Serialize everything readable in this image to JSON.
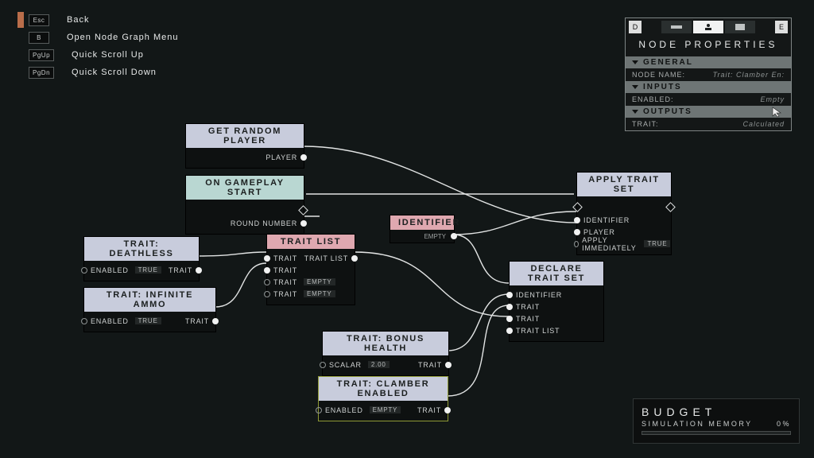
{
  "legend": {
    "rows": [
      {
        "key": "Esc",
        "label": "Back"
      },
      {
        "key": "B",
        "label": "Open Node Graph Menu"
      },
      {
        "key": "PgUp",
        "label": "Quick Scroll Up"
      },
      {
        "key": "PgDn",
        "label": "Quick Scroll Down"
      }
    ]
  },
  "nodes": {
    "getRandomPlayer": {
      "title": "GET RANDOM PLAYER",
      "outputs": [
        {
          "label": "PLAYER"
        }
      ]
    },
    "onGameplayStart": {
      "title": "ON GAMEPLAY START",
      "outputs": [
        {
          "label": "ROUND NUMBER"
        }
      ]
    },
    "traitDeathless": {
      "title": "TRAIT: DEATHLESS",
      "inputs": [
        {
          "label": "ENABLED",
          "value": "TRUE"
        }
      ],
      "outputs": [
        {
          "label": "TRAIT"
        }
      ]
    },
    "traitInfiniteAmmo": {
      "title": "TRAIT: INFINITE AMMO",
      "inputs": [
        {
          "label": "ENABLED",
          "value": "TRUE"
        }
      ],
      "outputs": [
        {
          "label": "TRAIT"
        }
      ]
    },
    "traitList": {
      "title": "TRAIT LIST",
      "inputs": [
        {
          "label": "TRAIT"
        },
        {
          "label": "TRAIT"
        },
        {
          "label": "TRAIT",
          "value": "EMPTY"
        },
        {
          "label": "TRAIT",
          "value": "EMPTY"
        }
      ],
      "outputs": [
        {
          "label": "TRAIT LIST"
        }
      ]
    },
    "identifier": {
      "title": "IDENTIFIER",
      "strip": "EMPTY"
    },
    "traitBonusHealth": {
      "title": "TRAIT: BONUS HEALTH",
      "inputs": [
        {
          "label": "SCALAR",
          "value": "2.00"
        }
      ],
      "outputs": [
        {
          "label": "TRAIT"
        }
      ]
    },
    "traitClamberEnabled": {
      "title": "TRAIT: CLAMBER ENABLED",
      "inputs": [
        {
          "label": "ENABLED",
          "value": "EMPTY"
        }
      ],
      "outputs": [
        {
          "label": "TRAIT"
        }
      ]
    },
    "declareTraitSet": {
      "title": "DECLARE TRAIT SET",
      "inputs": [
        {
          "label": "IDENTIFIER"
        },
        {
          "label": "TRAIT"
        },
        {
          "label": "TRAIT"
        },
        {
          "label": "TRAIT LIST"
        }
      ]
    },
    "applyTraitSet": {
      "title": "APPLY TRAIT SET",
      "inputs": [
        {
          "label": "IDENTIFIER"
        },
        {
          "label": "PLAYER"
        },
        {
          "label": "APPLY IMMEDIATELY",
          "value": "TRUE"
        }
      ]
    }
  },
  "panel": {
    "nav": {
      "left": "D",
      "right": "E"
    },
    "title": "NODE PROPERTIES",
    "sections": {
      "general": {
        "header": "GENERAL",
        "rows": [
          {
            "k": "NODE NAME:",
            "v": "Trait: Clamber En:"
          }
        ]
      },
      "inputs": {
        "header": "INPUTS",
        "rows": [
          {
            "k": "ENABLED:",
            "v": "Empty"
          }
        ]
      },
      "outputs": {
        "header": "OUTPUTS",
        "rows": [
          {
            "k": "TRAIT:",
            "v": "Calculated"
          }
        ]
      }
    }
  },
  "budget": {
    "title": "BUDGET",
    "label": "SIMULATION MEMORY",
    "value": "0%"
  }
}
